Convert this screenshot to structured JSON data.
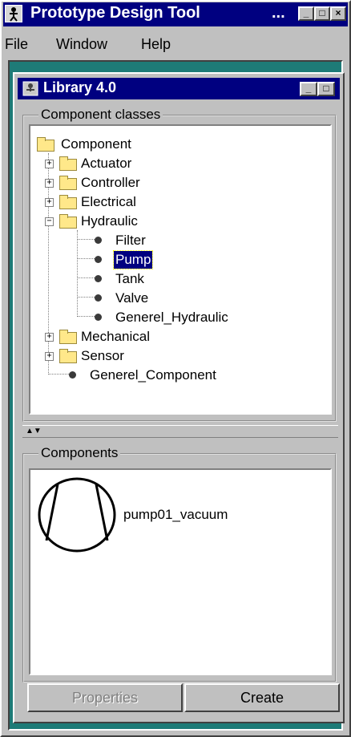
{
  "app": {
    "title": "Prototype Design Tool",
    "title_ellipsis": "...",
    "icon": "figure-icon",
    "window_buttons": {
      "minimize": "_",
      "maximize": "□",
      "close": "×"
    }
  },
  "menu": [
    {
      "label": "File"
    },
    {
      "label": "Window"
    },
    {
      "label": "Help"
    }
  ],
  "library": {
    "title": "Library 4.0",
    "window_buttons": {
      "minimize": "_",
      "maximize": "□"
    },
    "classes_label": "Component classes",
    "tree": {
      "root": "Component",
      "nodes": [
        {
          "label": "Actuator",
          "expander": "+"
        },
        {
          "label": "Controller",
          "expander": "+"
        },
        {
          "label": "Electrical",
          "expander": "+"
        },
        {
          "label": "Hydraulic",
          "expander": "−"
        },
        {
          "label": "Filter"
        },
        {
          "label": "Pump",
          "selected": true
        },
        {
          "label": "Tank"
        },
        {
          "label": "Valve"
        },
        {
          "label": "Generel_Hydraulic"
        },
        {
          "label": "Mechanical",
          "expander": "+"
        },
        {
          "label": "Sensor",
          "expander": "+"
        },
        {
          "label": "Generel_Component"
        }
      ]
    },
    "splitter_arrows": "▲▼",
    "components_label": "Components",
    "components": [
      {
        "name": "pump01_vacuum",
        "icon": "pump-symbol-icon"
      }
    ],
    "buttons": {
      "properties": "Properties",
      "create": "Create"
    }
  }
}
